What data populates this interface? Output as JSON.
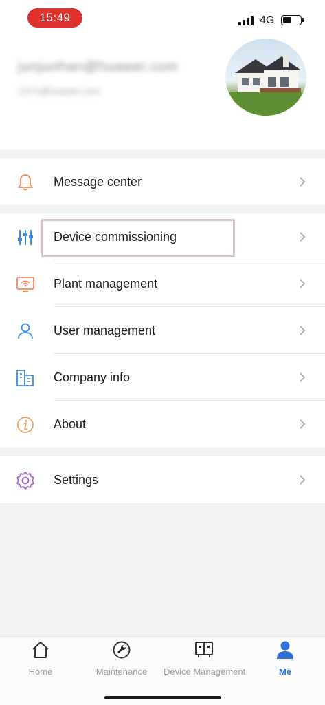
{
  "status_bar": {
    "time": "15:49",
    "network": "4G"
  },
  "profile": {
    "email": "junjunhan@huawei.com",
    "sub": "1371@huawei.com",
    "avatar": "house-photo"
  },
  "menu": {
    "group1": [
      {
        "label": "Message center",
        "icon": "bell-icon"
      }
    ],
    "group2": [
      {
        "label": "Device commissioning",
        "icon": "sliders-icon"
      },
      {
        "label": "Plant management",
        "icon": "plant-monitor-icon"
      },
      {
        "label": "User management",
        "icon": "user-icon"
      },
      {
        "label": "Company info",
        "icon": "building-icon"
      },
      {
        "label": "About",
        "icon": "info-icon"
      }
    ],
    "group3": [
      {
        "label": "Settings",
        "icon": "gear-icon"
      }
    ]
  },
  "bottom_nav": {
    "tabs": [
      {
        "label": "Home",
        "icon": "home-icon",
        "active": false
      },
      {
        "label": "Maintenance",
        "icon": "maintenance-icon",
        "active": false
      },
      {
        "label": "Device Management",
        "icon": "device-icon",
        "active": false
      },
      {
        "label": "Me",
        "icon": "person-icon",
        "active": true
      }
    ]
  },
  "colors": {
    "status_time_bg": "#e0332c",
    "active_tab": "#2f6fd8",
    "highlight_border": "#d8c4c9"
  }
}
